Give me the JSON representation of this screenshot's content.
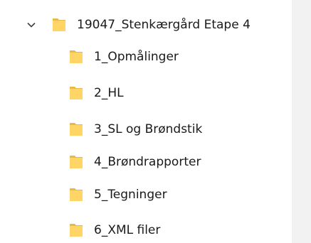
{
  "tree": {
    "root": {
      "label": "19047_Stenkærgård Etape 4",
      "expanded": true,
      "icon": "folder-icon",
      "chevron_icon": "chevron-down-icon"
    },
    "children": [
      {
        "label": "1_Opmålinger",
        "icon": "folder-icon"
      },
      {
        "label": "2_HL",
        "icon": "folder-icon"
      },
      {
        "label": "3_SL og Brøndstik",
        "icon": "folder-icon"
      },
      {
        "label": "4_Brøndrapporter",
        "icon": "folder-icon"
      },
      {
        "label": "5_Tegninger",
        "icon": "folder-icon"
      },
      {
        "label": "6_XML filer",
        "icon": "folder-icon"
      }
    ]
  },
  "colors": {
    "folder_body": "#FFD666",
    "folder_back": "#E8B84A",
    "pane_background": "#FFFFFF",
    "scrollbar_gutter": "#F2F2F2",
    "text": "#1A1A1A",
    "chevron": "#404040"
  }
}
